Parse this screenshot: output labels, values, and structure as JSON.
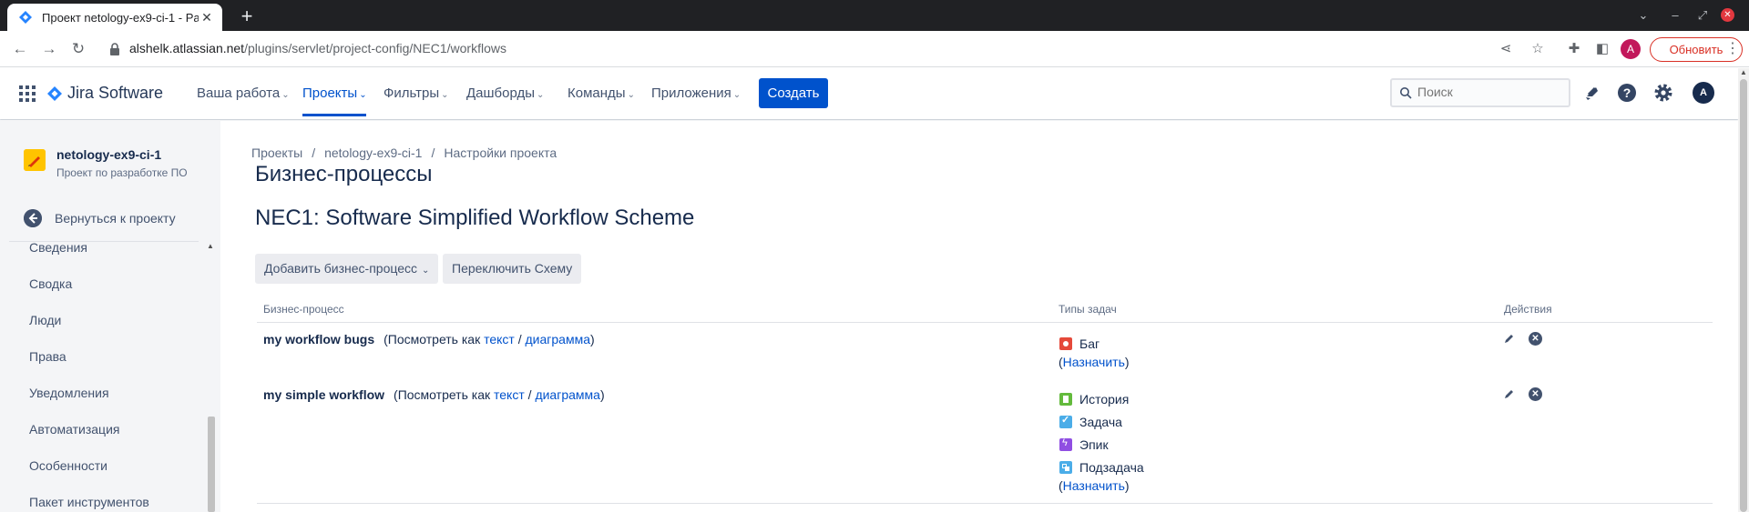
{
  "browser": {
    "tab_title": "Проект netology-ex9-ci-1 - Pa",
    "url_host": "alshelk.atlassian.net",
    "url_path": "/plugins/servlet/project-config/NEC1/workflows",
    "profile_initial": "A",
    "update_label": "Обновить"
  },
  "nav": {
    "product": "Jira Software",
    "menu": [
      "Ваша работа",
      "Проекты",
      "Фильтры",
      "Дашборды",
      "Команды",
      "Приложения"
    ],
    "active_menu": "Проекты",
    "create_label": "Создать",
    "search_placeholder": "Поиск",
    "user_initial": "A",
    "brand_color": "#0052CC"
  },
  "sidebar": {
    "project_name": "netology-ex9-ci-1",
    "project_type": "Проект по разработке ПО",
    "back_label": "Вернуться к проекту",
    "items": [
      "Сведения",
      "Сводка",
      "Люди",
      "Права",
      "Уведомления",
      "Автоматизация",
      "Особенности",
      "Пакет инструментов"
    ]
  },
  "main": {
    "breadcrumbs": [
      "Проекты",
      "netology-ex9-ci-1",
      "Настройки проекта"
    ],
    "title": "Бизнес-процессы",
    "scheme_title": "NEC1: Software Simplified Workflow Scheme",
    "add_workflow_label": "Добавить бизнес-процесс",
    "switch_scheme_label": "Переключить Схему",
    "columns": [
      "Бизнес-процесс",
      "Типы задач",
      "Действия"
    ],
    "workflows": [
      {
        "name": "my workflow bugs",
        "view_prefix": "(Посмотреть как",
        "text_link": "текст",
        "slash": "/",
        "diagram_link": "диаграмма",
        "view_suffix": ")",
        "issue_types": [
          {
            "name": "Баг",
            "icon": "bug-icon",
            "color": "#E5493A"
          }
        ],
        "assign_open": "(",
        "assign_link": "Назначить",
        "assign_close": ")"
      },
      {
        "name": "my simple workflow",
        "view_prefix": "(Посмотреть как",
        "text_link": "текст",
        "slash": "/",
        "diagram_link": "диаграмма",
        "view_suffix": ")",
        "issue_types": [
          {
            "name": "История",
            "icon": "story-icon",
            "color": "#63BA3C"
          },
          {
            "name": "Задача",
            "icon": "task-icon",
            "color": "#4BADE8"
          },
          {
            "name": "Эпик",
            "icon": "epic-icon",
            "color": "#904EE2"
          },
          {
            "name": "Подзадача",
            "icon": "subtask-icon",
            "color": "#4BADE8"
          }
        ],
        "assign_open": "(",
        "assign_link": "Назначить",
        "assign_close": ")"
      }
    ]
  }
}
